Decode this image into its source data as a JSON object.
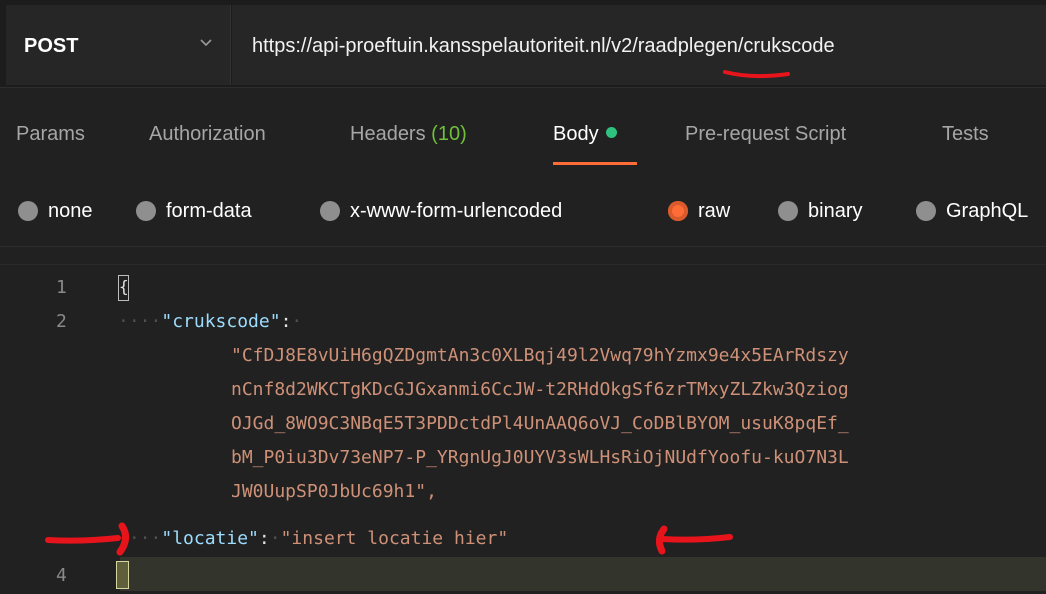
{
  "request": {
    "method": "POST",
    "url": "https://api-proeftuin.kansspelautoriteit.nl/v2/raadplegen/crukscode"
  },
  "tabs": [
    {
      "label": "Params",
      "count": ""
    },
    {
      "label": "Authorization",
      "count": ""
    },
    {
      "label": "Headers",
      "count": "(10)"
    },
    {
      "label": "Body",
      "count": "",
      "active": true
    },
    {
      "label": "Pre-request Script",
      "count": ""
    },
    {
      "label": "Tests",
      "count": ""
    }
  ],
  "body_types": [
    {
      "label": "none",
      "selected": false
    },
    {
      "label": "form-data",
      "selected": false
    },
    {
      "label": "x-www-form-urlencoded",
      "selected": false
    },
    {
      "label": "raw",
      "selected": true
    },
    {
      "label": "binary",
      "selected": false
    },
    {
      "label": "GraphQL",
      "selected": false
    }
  ],
  "editor": {
    "line_numbers": [
      "1",
      "2",
      "4"
    ],
    "crukscode_key": "\"crukscode\"",
    "crukscode_value_lines": [
      "\"CfDJ8E8vUiH6gQZDgmtAn3c0XLBqj49l2Vwq79hYzmx9e4x5EArRdszy",
      "nCnf8d2WKCTgKDcGJGxanmi6CcJW-t2RHdOkgSf6zrTMxyZLZkw3Qziog",
      "OJGd_8WO9C3NBqE5T3PDDctdPl4UnAAQ6oVJ_CoDBlBYOM_usuK8pqEf_",
      "bM_P0iu3Dv73eNP7-P_YRgnUgJ0UYV3sWLHsRiOjNUdfYoofu-kuO7N3L",
      "JW0UupSP0JbUc69h1\","
    ],
    "locatie_key": "\"locatie\"",
    "locatie_value": "\"insert locatie hier\""
  },
  "colors": {
    "accent": "#ff6c37",
    "status_dot": "#2ec27e",
    "headers_count": "#6fbf3b",
    "annotation": "#e8141c"
  }
}
